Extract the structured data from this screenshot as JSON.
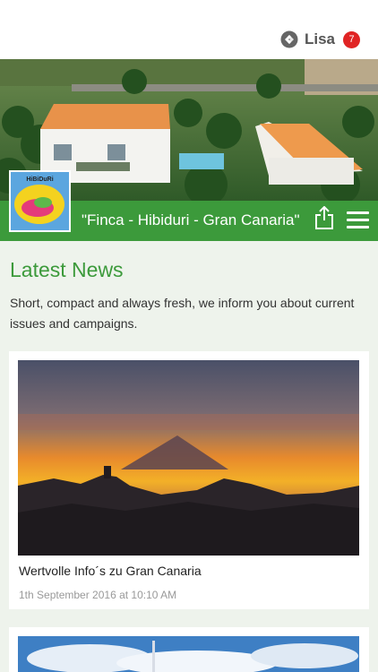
{
  "user": {
    "name": "Lisa",
    "badge_count": "7",
    "icon": "sync-icon"
  },
  "site": {
    "title": "\"Finca - Hibiduri - Gran Canaria\"",
    "logo_text": "HiBiDuRi",
    "share_icon": "share-icon",
    "menu_icon": "hamburger-menu-icon"
  },
  "news": {
    "heading": "Latest News",
    "intro": "Short, compact and always fresh, we inform you about current issues and campaigns.",
    "items": [
      {
        "title": "Wertvolle Info´s zu Gran Canaria",
        "date": "1th September 2016 at 10:10 AM"
      },
      {
        "title": "",
        "date": ""
      }
    ]
  },
  "colors": {
    "brand_green": "#3c9a3b",
    "badge_red": "#e02424",
    "background": "#eef3ec"
  }
}
